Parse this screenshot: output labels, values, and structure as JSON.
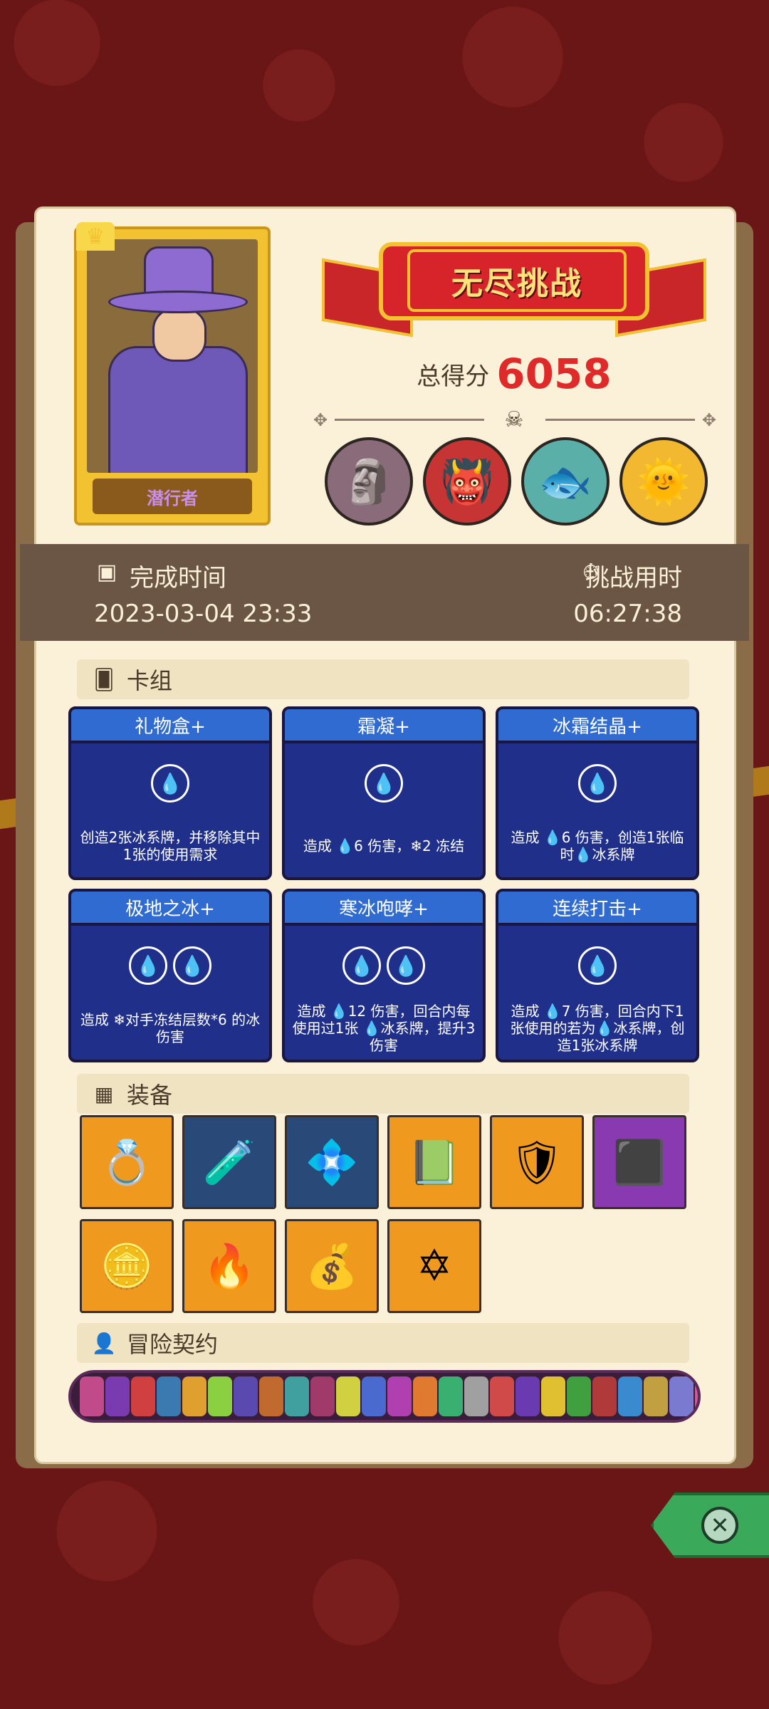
{
  "hero": {
    "name": "潜行者"
  },
  "banner": {
    "title": "无尽挑战"
  },
  "score": {
    "label": "总得分",
    "value": "6058"
  },
  "time": {
    "completion_label": "完成时间",
    "completion_value": "2023-03-04 23:33",
    "duration_label": "挑战用时",
    "duration_value": "06:27:38"
  },
  "sections": {
    "deck": "卡组",
    "equipment": "装备",
    "contracts": "冒险契约"
  },
  "cards": [
    {
      "name": "礼物盒+",
      "cost": 1,
      "desc": "创造2张冰系牌，并移除其中1张的使用需求"
    },
    {
      "name": "霜凝+",
      "cost": 1,
      "desc": "造成 💧6 伤害，❄2 冻结"
    },
    {
      "name": "冰霜结晶+",
      "cost": 1,
      "desc": "造成 💧6 伤害，创造1张临时💧冰系牌"
    },
    {
      "name": "极地之冰+",
      "cost": 2,
      "desc": "造成 ❄对手冻结层数*6 的冰伤害"
    },
    {
      "name": "寒冰咆哮+",
      "cost": 2,
      "desc": "造成 💧12 伤害，回合内每使用过1张 💧冰系牌，提升3伤害"
    },
    {
      "name": "连续打击+",
      "cost": 1,
      "desc": "造成 💧7 伤害，回合内下1张使用的若为💧冰系牌，创造1张冰系牌"
    }
  ],
  "equipment": [
    {
      "icon": "ring-icon",
      "glyph": "💍",
      "color": "orange"
    },
    {
      "icon": "potion-icon",
      "glyph": "🧪",
      "color": "navy"
    },
    {
      "icon": "ice-emblem-icon",
      "glyph": "💠",
      "color": "navy"
    },
    {
      "icon": "book-icon",
      "glyph": "📗",
      "color": "orange"
    },
    {
      "icon": "shield-icon",
      "glyph": "🛡",
      "color": "orange"
    },
    {
      "icon": "cube-icon",
      "glyph": "⬛",
      "color": "purple"
    },
    {
      "icon": "medallion-icon",
      "glyph": "🪙",
      "color": "orange"
    },
    {
      "icon": "flame-icon",
      "glyph": "🔥",
      "color": "orange"
    },
    {
      "icon": "bag-icon",
      "glyph": "💰",
      "color": "orange"
    },
    {
      "icon": "star-icon",
      "glyph": "✡",
      "color": "orange"
    }
  ],
  "bosses": [
    {
      "icon": "stone-golem-icon",
      "glyph": "🗿"
    },
    {
      "icon": "cage-beast-icon",
      "glyph": "👹"
    },
    {
      "icon": "fish-boss-icon",
      "glyph": "🐟"
    },
    {
      "icon": "sun-boss-icon",
      "glyph": "🌞"
    }
  ],
  "contract_colors": [
    "#c04a8a",
    "#7a3ab0",
    "#d04040",
    "#3a7ab0",
    "#e0a030",
    "#8ad040",
    "#5a4ab0",
    "#c06a30",
    "#40a0a0",
    "#a03a6a",
    "#d0d040",
    "#4a6ad0",
    "#b040b0",
    "#e07a30",
    "#3ab070",
    "#a0a0a0",
    "#d04a4a",
    "#6a3ab0",
    "#e0c030",
    "#40a040",
    "#b03a3a",
    "#3a8ad0",
    "#c0a040",
    "#7a7ad0",
    "#d05a9a",
    "#5aa0c0",
    "#e08a40",
    "#a04ab0"
  ]
}
